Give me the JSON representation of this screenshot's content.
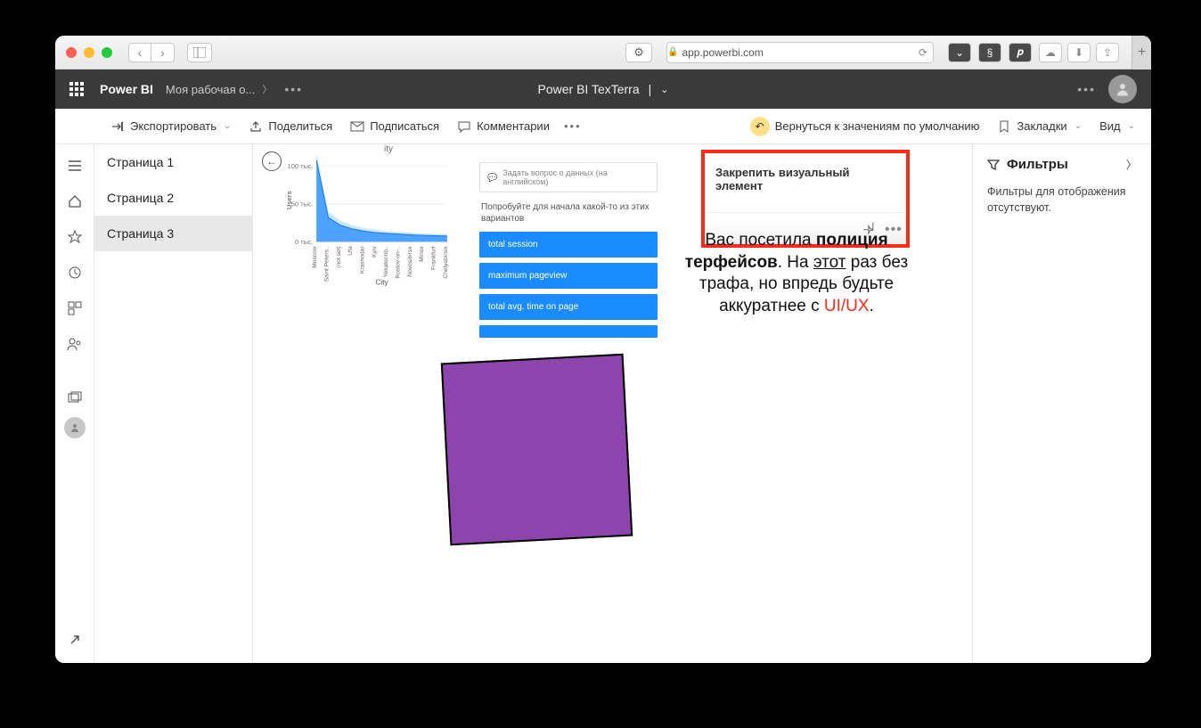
{
  "browser": {
    "url_host": "app.powerbi.com"
  },
  "header": {
    "brand": "Power BI",
    "workspace": "Моя рабочая о...",
    "title": "Power BI TexTerra"
  },
  "toolbar": {
    "export": "Экспортировать",
    "share": "Поделиться",
    "subscribe": "Подписаться",
    "comments": "Комментарии",
    "reset": "Вернуться к значениям по умолчанию",
    "bookmarks": "Закладки",
    "view": "Вид"
  },
  "pages": {
    "items": [
      {
        "label": "Страница 1"
      },
      {
        "label": "Страница 2"
      },
      {
        "label": "Страница 3"
      }
    ],
    "active": 2
  },
  "qna": {
    "placeholder": "Задать вопрос о данных (на английском)",
    "suggest_label": "Попробуйте для начала какой-то из этих вариантов",
    "suggestions": [
      "total session",
      "maximum pageview",
      "total avg. time on page"
    ]
  },
  "pin": {
    "tooltip": "Закрепить визуальный элемент"
  },
  "overlay": {
    "t1": "Вас посетила ",
    "t2": "полиция ",
    "t3": "терфейсов",
    "t4": ". На ",
    "t5": "этот",
    "t6": " раз без ",
    "t7": "трафа, но впредь будьте аккуратнее с ",
    "t8": "UI/UX",
    "t9": "."
  },
  "filters": {
    "title": "Фильтры",
    "empty": "Фильтры для отображения отсутствуют."
  },
  "chart_data": {
    "type": "area",
    "title": "ity",
    "ylabel": "Users",
    "xlabel": "City",
    "ylim": [
      0,
      110000
    ],
    "yticks": [
      "0 тыс.",
      "50 тыс.",
      "100 тыс."
    ],
    "categories": [
      "Moscow",
      "Saint Peters..",
      "(not set)",
      "Ufa",
      "Krasnodar",
      "Kyiv",
      "Yekaterinb..",
      "Rostov-on-..",
      "Novosibirsk",
      "Minsk",
      "Frankfurt",
      "Chelyabinsk"
    ],
    "values": [
      108000,
      32000,
      22000,
      17000,
      14000,
      12000,
      11000,
      10000,
      9000,
      8500,
      8000,
      7500
    ],
    "values2": [
      118000,
      40000,
      28000,
      22000,
      18000,
      16000,
      14000,
      13000,
      12000,
      11000,
      10500,
      10000
    ]
  }
}
